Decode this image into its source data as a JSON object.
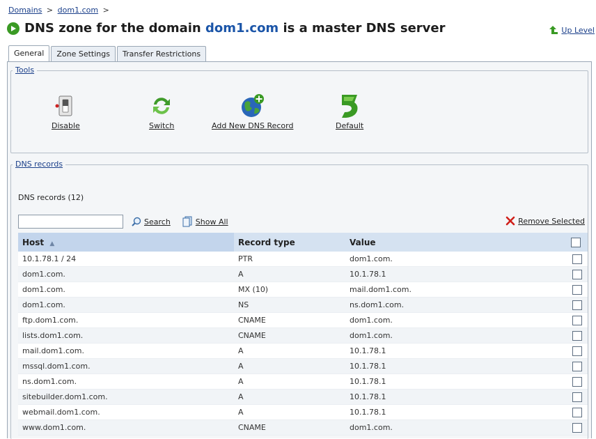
{
  "breadcrumb": {
    "items": [
      "Domains",
      "dom1.com"
    ],
    "separator": ">"
  },
  "header": {
    "title_prefix": "DNS zone for the domain",
    "domain": "dom1.com",
    "title_suffix": "is a master DNS server",
    "up_level": "Up Level",
    "status_color": "#3a9a24"
  },
  "tabs": [
    {
      "label": "General",
      "active": true
    },
    {
      "label": "Zone Settings",
      "active": false
    },
    {
      "label": "Transfer Restrictions",
      "active": false
    }
  ],
  "tools": {
    "legend": "Tools",
    "items": [
      {
        "label": "Disable",
        "icon": "switch-toggle-icon"
      },
      {
        "label": "Switch",
        "icon": "refresh-arrows-icon"
      },
      {
        "label": "Add New DNS Record",
        "icon": "globe-add-icon"
      },
      {
        "label": "Default",
        "icon": "green-arrow-icon"
      }
    ]
  },
  "dns": {
    "legend": "DNS records",
    "count_label": "DNS records (12)",
    "search_placeholder": "",
    "search_label": "Search",
    "show_all_label": "Show All",
    "remove_selected_label": "Remove Selected",
    "columns": [
      "Host",
      "Record type",
      "Value"
    ],
    "sort_indicator": "▲",
    "rows": [
      {
        "host": "10.1.78.1 / 24",
        "type": "PTR",
        "value": "dom1.com."
      },
      {
        "host": "dom1.com.",
        "type": "A",
        "value": "10.1.78.1"
      },
      {
        "host": "dom1.com.",
        "type": "MX (10)",
        "value": "mail.dom1.com."
      },
      {
        "host": "dom1.com.",
        "type": "NS",
        "value": "ns.dom1.com."
      },
      {
        "host": "ftp.dom1.com.",
        "type": "CNAME",
        "value": "dom1.com."
      },
      {
        "host": "lists.dom1.com.",
        "type": "CNAME",
        "value": "dom1.com."
      },
      {
        "host": "mail.dom1.com.",
        "type": "A",
        "value": "10.1.78.1"
      },
      {
        "host": "mssql.dom1.com.",
        "type": "A",
        "value": "10.1.78.1"
      },
      {
        "host": "ns.dom1.com.",
        "type": "A",
        "value": "10.1.78.1"
      },
      {
        "host": "sitebuilder.dom1.com.",
        "type": "A",
        "value": "10.1.78.1"
      },
      {
        "host": "webmail.dom1.com.",
        "type": "A",
        "value": "10.1.78.1"
      },
      {
        "host": "www.dom1.com.",
        "type": "CNAME",
        "value": "dom1.com."
      }
    ]
  }
}
